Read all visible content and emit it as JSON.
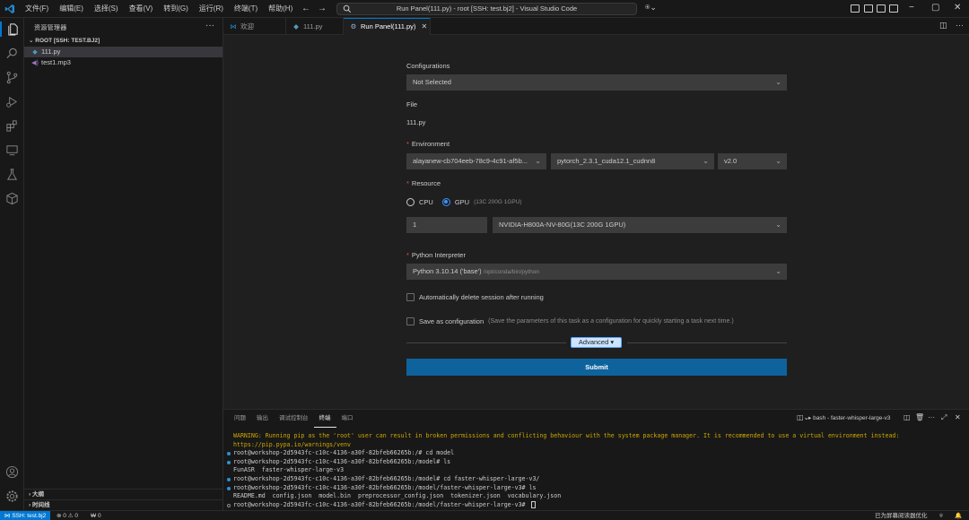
{
  "window": {
    "title": "Run Panel(111.py) - root [SSH: test.bj2] - Visual Studio Code",
    "menu": [
      "文件(F)",
      "编辑(E)",
      "选择(S)",
      "查看(V)",
      "转到(G)",
      "运行(R)",
      "终端(T)",
      "帮助(H)"
    ],
    "controls": {
      "minimize": "−",
      "maximize": "▢",
      "close": "✕"
    }
  },
  "sidebar": {
    "title": "资源管理器",
    "more": "···",
    "root_label": "ROOT [SSH: TEST.BJ2]",
    "files": [
      {
        "name": "111.py",
        "icon": "python-file-icon",
        "selected": true
      },
      {
        "name": "test1.mp3",
        "icon": "audio-file-icon",
        "selected": false
      }
    ],
    "sections": [
      "大纲",
      "时间线"
    ]
  },
  "tabs": [
    {
      "label": "欢迎",
      "icon": "vscode-logo-icon",
      "active": false
    },
    {
      "label": "111.py",
      "icon": "python-file-icon",
      "active": false
    },
    {
      "label": "Run Panel(111.py)",
      "icon": "run-panel-icon",
      "active": true,
      "close": "✕"
    }
  ],
  "run_panel": {
    "configurations": {
      "label": "Configurations",
      "value": "Not Selected"
    },
    "file": {
      "label": "File",
      "value": "111.py"
    },
    "environment": {
      "label": "Environment",
      "image": "alayanew-cb704eeb-78c9-4c91-af5b...",
      "framework": "pytorch_2.3.1_cuda12.1_cudnn8",
      "version": "v2.0"
    },
    "resource": {
      "label": "Resource",
      "cpu_label": "CPU",
      "gpu_label": "GPU",
      "gpu_hint": "(13C 200G 1GPU)",
      "selected": "GPU",
      "count": "1",
      "spec": "NVIDIA-H800A-NV-80G(13C 200G 1GPU)"
    },
    "interpreter": {
      "label": "Python Interpreter",
      "value": "Python 3.10.14 ('base')",
      "path": "/opt/conda/bin/python"
    },
    "auto_delete": {
      "label": "Automatically delete session after running",
      "checked": false
    },
    "save_config": {
      "label": "Save as configuration",
      "hint": "(Save the parameters of this task as a configuration for quickly starting a task next time.)",
      "checked": false
    },
    "advanced_label": "Advanced",
    "submit_label": "Submit"
  },
  "panel": {
    "tabs": [
      {
        "label": "问题",
        "active": false
      },
      {
        "label": "输出",
        "active": false
      },
      {
        "label": "调试控制台",
        "active": false
      },
      {
        "label": "终端",
        "active": true
      },
      {
        "label": "端口",
        "active": false
      }
    ],
    "terminal_title": "bash - faster-whisper-large-v3",
    "lines": [
      {
        "text": "WARNING: Running pip as the 'root' user can result in broken permissions and conflicting behaviour with the system package manager. It is recommended to use a virtual environment instead: https://pip.pypa.io/warnings/venv",
        "type": "warn"
      },
      {
        "text": "root@workshop-2d5943fc-c10c-4136-a30f-82bfeb66265b:/# cd model",
        "type": "cmd"
      },
      {
        "text": "root@workshop-2d5943fc-c10c-4136-a30f-82bfeb66265b:/model# ls",
        "type": "cmd"
      },
      {
        "text": "FunASR  faster-whisper-large-v3",
        "type": "out"
      },
      {
        "text": "root@workshop-2d5943fc-c10c-4136-a30f-82bfeb66265b:/model# cd faster-whisper-large-v3/",
        "type": "cmd"
      },
      {
        "text": "root@workshop-2d5943fc-c10c-4136-a30f-82bfeb66265b:/model/faster-whisper-large-v3# ls",
        "type": "cmd"
      },
      {
        "text": "README.md  config.json  model.bin  preprocessor_config.json  tokenizer.json  vocabulary.json",
        "type": "out"
      },
      {
        "text": "root@workshop-2d5943fc-c10c-4136-a30f-82bfeb66265b:/model/faster-whisper-large-v3# ",
        "type": "prompt"
      }
    ]
  },
  "statusbar": {
    "remote": "SSH: test.bj2",
    "errors": "0",
    "warnings": "0",
    "ports": "0",
    "screen_reader": "已为屏幕阅读器优化"
  },
  "colors": {
    "accent": "#0078d4",
    "submit": "#0e639c",
    "required": "#f14c4c",
    "warning_text": "#cca700"
  }
}
